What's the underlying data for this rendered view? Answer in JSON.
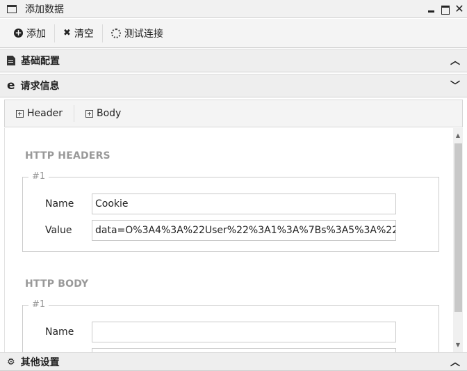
{
  "window": {
    "title": "添加数据"
  },
  "toolbar": {
    "add_label": "添加",
    "clear_label": "清空",
    "test_label": "测试连接"
  },
  "panels": {
    "basic": "基础配置",
    "request": "请求信息",
    "other": "其他设置"
  },
  "subtabs": {
    "header": "Header",
    "body": "Body"
  },
  "headers_section": {
    "title": "HTTP HEADERS",
    "legend": "#1",
    "name_label": "Name",
    "value_label": "Value",
    "name_value": "Cookie",
    "value_value": "data=O%3A4%3A%22User%22%3A1%3A%7Bs%3A5%3A%22"
  },
  "body_section": {
    "title": "HTTP BODY",
    "legend": "#1",
    "name_label": "Name",
    "name_value": ""
  }
}
